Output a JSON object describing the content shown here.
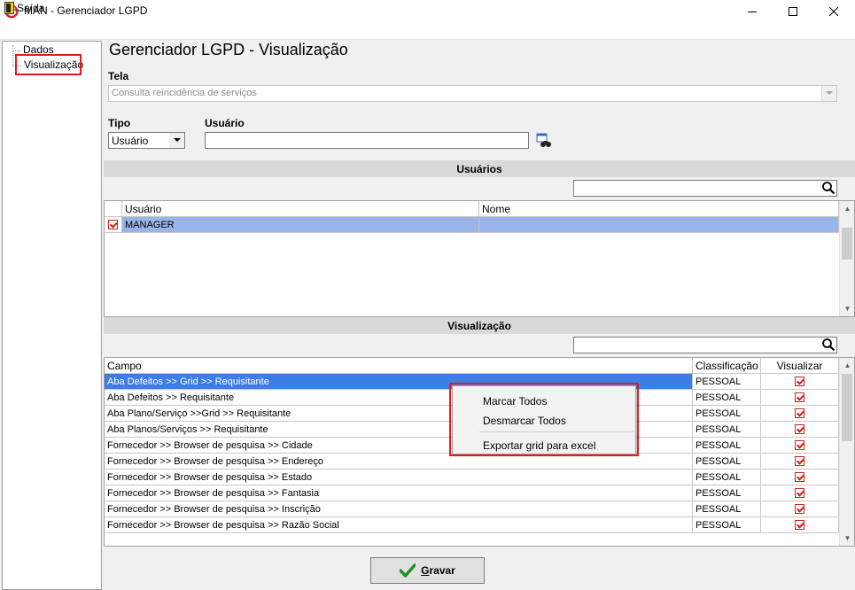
{
  "window": {
    "title": "MAN - Gerenciador LGPD",
    "icons": {
      "app": "app-logo-icon",
      "minimize": "minimize-icon",
      "maximize": "maximize-icon",
      "close": "close-icon"
    }
  },
  "menubar": {
    "exit_label": "Saída",
    "exit_icon": "door-exit-icon"
  },
  "tree": {
    "items": [
      {
        "label": "Dados"
      },
      {
        "label": "Visualização",
        "selected": true
      }
    ]
  },
  "main": {
    "title": "Gerenciador LGPD - Visualização",
    "tela": {
      "label": "Tela",
      "value": "Consulta reincidência de serviços"
    },
    "tipo": {
      "label": "Tipo",
      "value": "Usuário"
    },
    "usuario": {
      "label": "Usuário",
      "value": ""
    }
  },
  "usuarios_section": {
    "title": "Usuários",
    "search_value": "",
    "columns": [
      "Usuário",
      "Nome"
    ],
    "rows": [
      {
        "checked": true,
        "usuario": "MANAGER",
        "nome": ""
      }
    ]
  },
  "visualizacao_section": {
    "title": "Visualização",
    "search_value": "",
    "columns": [
      "Campo",
      "Classificação",
      "Visualizar"
    ],
    "rows": [
      {
        "campo": "Aba Defeitos >> Grid >> Requisitante",
        "classificacao": "PESSOAL",
        "visualizar": true
      },
      {
        "campo": "Aba Defeitos >> Requisitante",
        "classificacao": "PESSOAL",
        "visualizar": true
      },
      {
        "campo": "Aba Plano/Serviço >>Grid >> Requisitante",
        "classificacao": "PESSOAL",
        "visualizar": true
      },
      {
        "campo": "Aba Planos/Serviços >> Requisitante",
        "classificacao": "PESSOAL",
        "visualizar": true
      },
      {
        "campo": "Fornecedor >> Browser de pesquisa >> Cidade",
        "classificacao": "PESSOAL",
        "visualizar": true
      },
      {
        "campo": "Fornecedor >> Browser de pesquisa >> Endereço",
        "classificacao": "PESSOAL",
        "visualizar": true
      },
      {
        "campo": "Fornecedor >> Browser de pesquisa >> Estado",
        "classificacao": "PESSOAL",
        "visualizar": true
      },
      {
        "campo": "Fornecedor >> Browser de pesquisa >> Fantasia",
        "classificacao": "PESSOAL",
        "visualizar": true
      },
      {
        "campo": "Fornecedor >> Browser de pesquisa >> Inscrição",
        "classificacao": "PESSOAL",
        "visualizar": true
      },
      {
        "campo": "Fornecedor >> Browser de pesquisa >> Razão Social",
        "classificacao": "PESSOAL",
        "visualizar": true
      }
    ]
  },
  "context_menu": {
    "items": [
      "Marcar Todos",
      "Desmarcar Todos",
      "Exportar grid para excel"
    ]
  },
  "footer": {
    "save_label_first": "G",
    "save_label_rest": "ravar"
  },
  "colors": {
    "selection": "#3c7ee6",
    "highlight_box": "#e51b1b",
    "check": "#cf1f1f"
  }
}
